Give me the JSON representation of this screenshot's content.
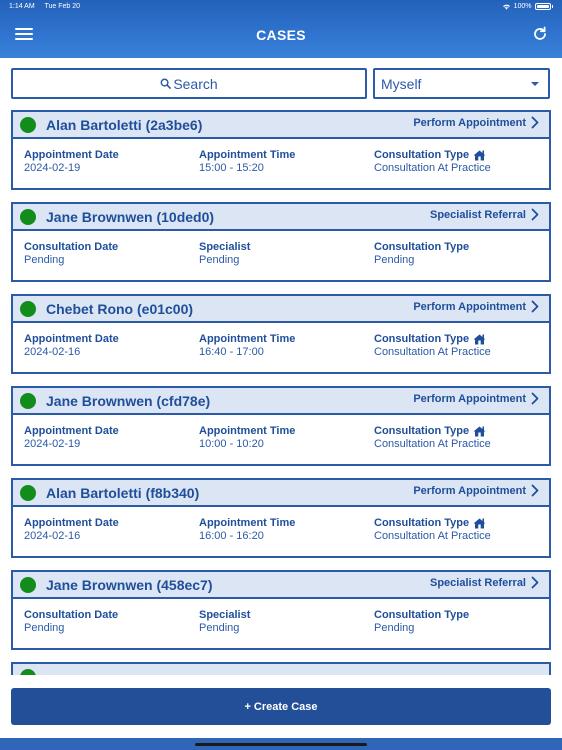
{
  "status_bar": {
    "time": "1:14 AM",
    "date": "Tue Feb 20",
    "battery": "100%"
  },
  "header": {
    "title": "CASES"
  },
  "search": {
    "label": "Search"
  },
  "filter": {
    "selected": "Myself"
  },
  "cases": [
    {
      "patient": "Alan Bartoletti (2a3be6)",
      "action": "Perform Appointment",
      "col1": {
        "label": "Appointment Date",
        "value": "2024-02-19"
      },
      "col2": {
        "label": "Appointment Time",
        "value": "15:00 - 15:20"
      },
      "col3": {
        "label": "Consultation Type",
        "value": "Consultation At Practice"
      }
    },
    {
      "patient": "Jane Brownwen (10ded0)",
      "action": "Specialist Referral",
      "col1": {
        "label": "Consultation Date",
        "value": "Pending"
      },
      "col2": {
        "label": "Specialist",
        "value": "Pending"
      },
      "col3": {
        "label": "Consultation Type",
        "value": "Pending"
      }
    },
    {
      "patient": "Chebet Rono (e01c00)",
      "action": "Perform Appointment",
      "col1": {
        "label": "Appointment Date",
        "value": "2024-02-16"
      },
      "col2": {
        "label": "Appointment Time",
        "value": "16:40 - 17:00"
      },
      "col3": {
        "label": "Consultation Type",
        "value": "Consultation At Practice"
      }
    },
    {
      "patient": "Jane Brownwen (cfd78e)",
      "action": "Perform Appointment",
      "col1": {
        "label": "Appointment Date",
        "value": "2024-02-19"
      },
      "col2": {
        "label": "Appointment Time",
        "value": "10:00 - 10:20"
      },
      "col3": {
        "label": "Consultation Type",
        "value": "Consultation At Practice"
      }
    },
    {
      "patient": "Alan Bartoletti (f8b340)",
      "action": "Perform Appointment",
      "col1": {
        "label": "Appointment Date",
        "value": "2024-02-16"
      },
      "col2": {
        "label": "Appointment Time",
        "value": "16:00 - 16:20"
      },
      "col3": {
        "label": "Consultation Type",
        "value": "Consultation At Practice"
      }
    },
    {
      "patient": "Jane Brownwen (458ec7)",
      "action": "Specialist Referral",
      "col1": {
        "label": "Consultation Date",
        "value": "Pending"
      },
      "col2": {
        "label": "Specialist",
        "value": "Pending"
      },
      "col3": {
        "label": "Consultation Type",
        "value": "Pending"
      }
    }
  ],
  "create_button": {
    "label": "+ Create Case"
  },
  "colors": {
    "primary": "#234f98",
    "card_header": "#dbe5f4",
    "status_ok": "#128c1a"
  }
}
